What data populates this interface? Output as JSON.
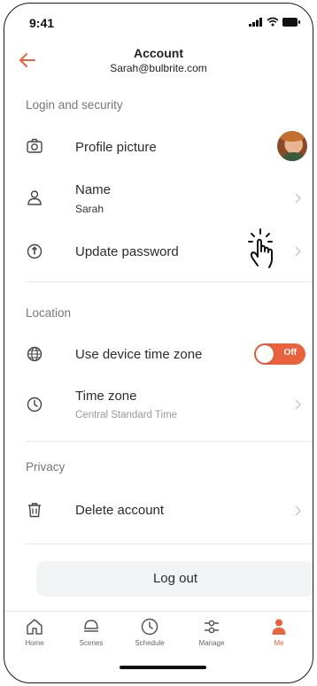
{
  "status_bar": {
    "time": "9:41"
  },
  "header": {
    "title": "Account",
    "subtitle": "Sarah@bulbrite.com"
  },
  "sections": {
    "login": "Login and security",
    "location": "Location",
    "privacy": "Privacy"
  },
  "rows": {
    "profile_picture": {
      "label": "Profile picture",
      "icon": "camera-icon"
    },
    "name": {
      "label": "Name",
      "value": "Sarah",
      "icon": "person-icon"
    },
    "update_password": {
      "label": "Update password",
      "icon": "key-icon"
    },
    "device_time_zone": {
      "label": "Use device time zone",
      "icon": "globe-icon",
      "toggle_label": "Off",
      "toggle_on": false
    },
    "time_zone": {
      "label": "Time zone",
      "value": "Central Standard Time",
      "icon": "clock-icon"
    },
    "delete_account": {
      "label": "Delete account",
      "icon": "trash-icon"
    }
  },
  "logout_label": "Log out",
  "tabs": [
    {
      "label": "Home",
      "icon": "home-icon"
    },
    {
      "label": "Scenes",
      "icon": "scenes-icon"
    },
    {
      "label": "Schedule",
      "icon": "clock-icon"
    },
    {
      "label": "Manage",
      "icon": "sliders-icon"
    },
    {
      "label": "Me",
      "icon": "person-icon",
      "active": true
    }
  ],
  "colors": {
    "accent": "#e8623d",
    "section_text": "#777777",
    "divider": "#e7e7e7"
  }
}
